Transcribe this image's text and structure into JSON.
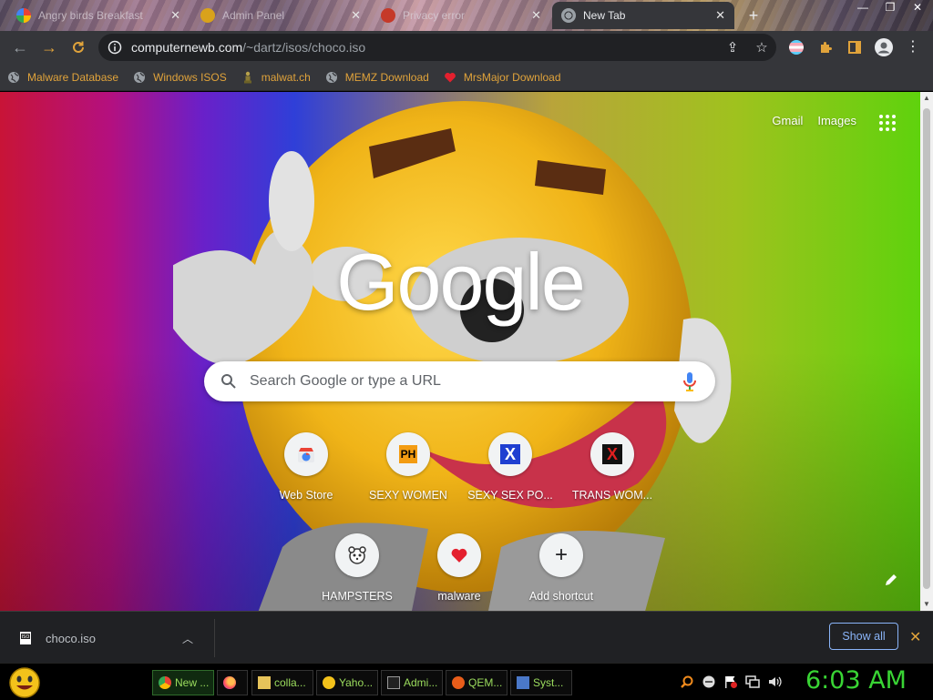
{
  "tabs": [
    {
      "title": "Angry birds Breakfast",
      "active": false
    },
    {
      "title": "Admin Panel",
      "active": false
    },
    {
      "title": "Privacy error",
      "active": false
    },
    {
      "title": "New Tab",
      "active": true
    }
  ],
  "toolbar": {
    "url_host": "computernewb.com",
    "url_path": "/~dartz/isos/choco.iso"
  },
  "bookmarks": [
    {
      "label": "Malware Database",
      "icon": "globe-icon"
    },
    {
      "label": "Windows ISOS",
      "icon": "globe-icon"
    },
    {
      "label": "malwat.ch",
      "icon": "figure-icon"
    },
    {
      "label": "MEMZ Download",
      "icon": "globe-icon"
    },
    {
      "label": "MrsMajor Download",
      "icon": "heart-icon"
    }
  ],
  "newtab": {
    "gmail": "Gmail",
    "images": "Images",
    "logo": "Google",
    "search_placeholder": "Search Google or type a URL",
    "shortcuts": [
      {
        "label": "Web Store",
        "icon": "chrome-webstore-icon"
      },
      {
        "label": "SEXY WOMEN",
        "icon": "ph-icon"
      },
      {
        "label": "SEXY SEX PO...",
        "icon": "blue-x-icon"
      },
      {
        "label": "TRANS WOM...",
        "icon": "red-x-icon"
      },
      {
        "label": "HAMPSTERS",
        "icon": "hamster-icon"
      },
      {
        "label": "malware",
        "icon": "heart-icon"
      },
      {
        "label": "Add shortcut",
        "icon": "plus-icon"
      }
    ]
  },
  "downloads": {
    "file": "choco.iso",
    "show_all": "Show all"
  },
  "taskbar": {
    "items": [
      {
        "label": "New ...",
        "icon": "chrome-icon",
        "active": true
      },
      {
        "label": "",
        "icon": "firefox-icon",
        "active": false
      },
      {
        "label": "colla...",
        "icon": "folder-icon",
        "active": false
      },
      {
        "label": "Yaho...",
        "icon": "smiley-icon",
        "active": false
      },
      {
        "label": "Admi...",
        "icon": "console-icon",
        "active": false
      },
      {
        "label": "QEM...",
        "icon": "qemu-icon",
        "active": false
      },
      {
        "label": "Syst...",
        "icon": "system-icon",
        "active": false
      }
    ],
    "clock": "6:03 AM"
  }
}
